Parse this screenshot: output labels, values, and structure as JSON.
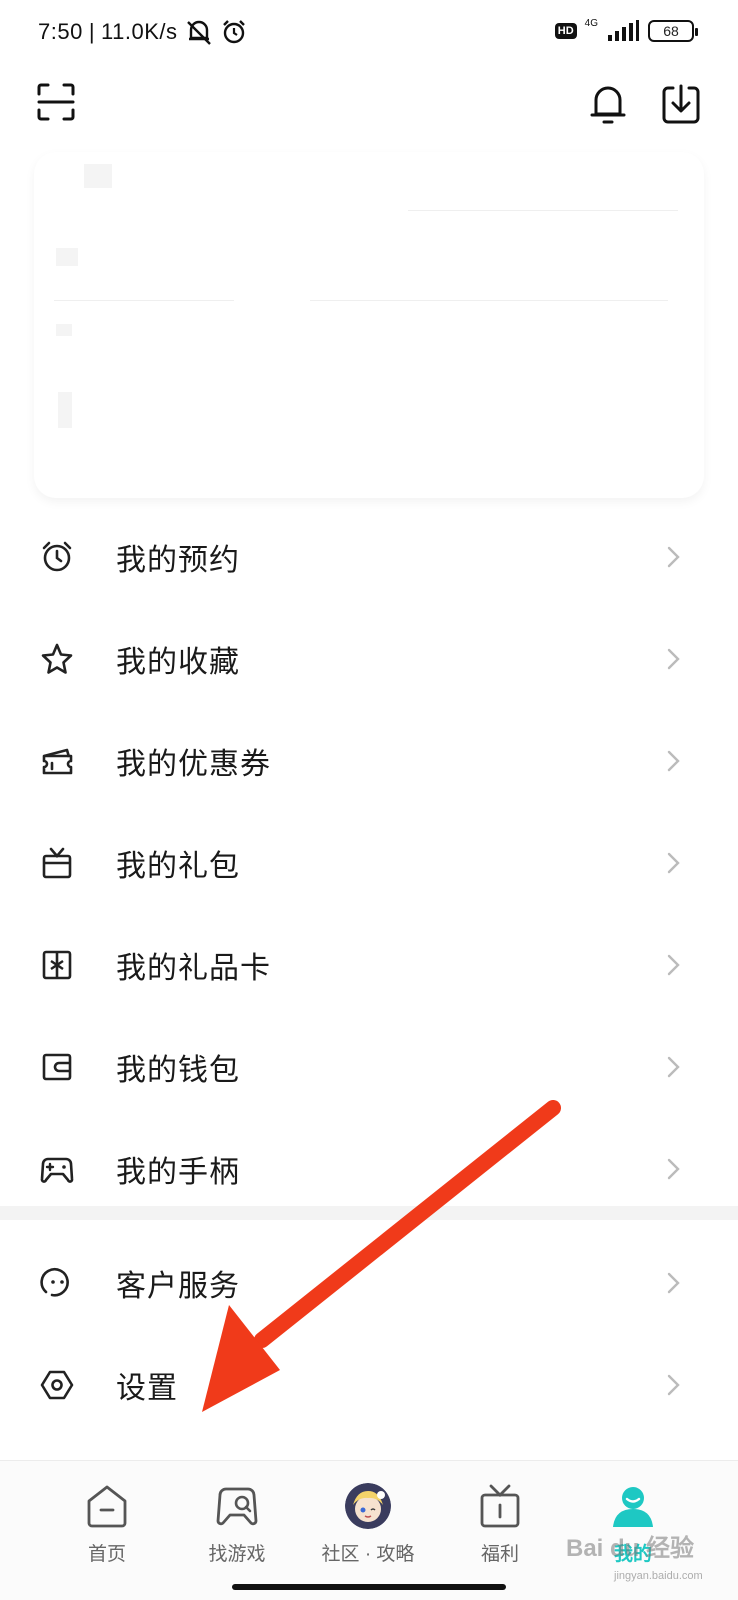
{
  "status_bar": {
    "time": "7:50",
    "speed": "11.0K/s",
    "hd": "HD",
    "network": "4G",
    "battery": "68"
  },
  "menu_group_1": [
    {
      "label": "我的预约",
      "icon": "alarm-clock-icon"
    },
    {
      "label": "我的收藏",
      "icon": "star-icon"
    },
    {
      "label": "我的优惠券",
      "icon": "coupon-icon"
    },
    {
      "label": "我的礼包",
      "icon": "gift-icon"
    },
    {
      "label": "我的礼品卡",
      "icon": "gift-card-icon"
    },
    {
      "label": "我的钱包",
      "icon": "wallet-icon"
    },
    {
      "label": "我的手柄",
      "icon": "gamepad-icon"
    }
  ],
  "menu_group_2": [
    {
      "label": "客户服务",
      "icon": "customer-service-icon"
    },
    {
      "label": "设置",
      "icon": "settings-hexagon-icon"
    }
  ],
  "bottom_nav": {
    "items": [
      {
        "label": "首页",
        "icon": "home-icon"
      },
      {
        "label": "找游戏",
        "icon": "find-game-icon"
      },
      {
        "label": "社区 · 攻略",
        "icon": "community-avatar-icon"
      },
      {
        "label": "福利",
        "icon": "welfare-gift-icon"
      },
      {
        "label": "我的",
        "icon": "profile-icon"
      }
    ],
    "active_color": "#1ec8c3"
  },
  "watermark": {
    "main": "Bai du 经验",
    "sub": "jingyan.baidu.com"
  },
  "colors": {
    "accent": "#1ec8c3",
    "annotation_arrow": "#f03a1a"
  }
}
